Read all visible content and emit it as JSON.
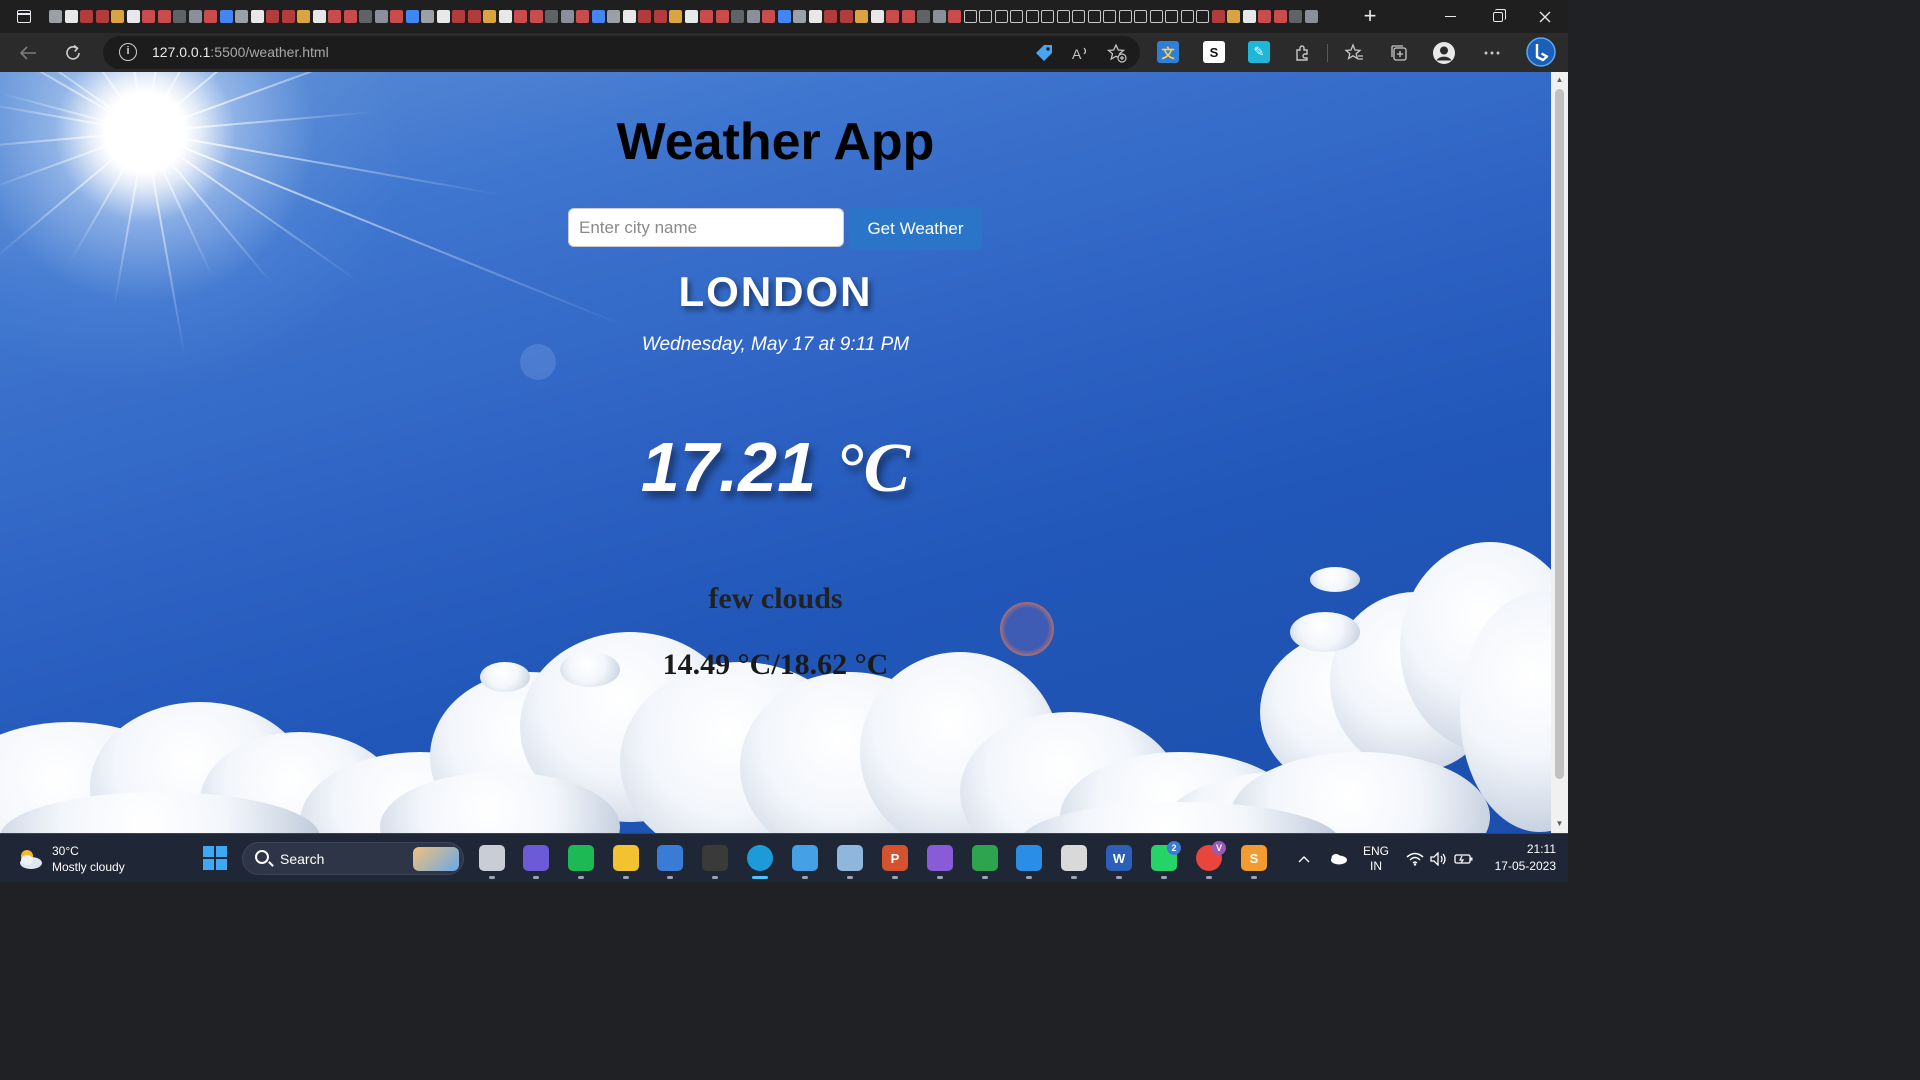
{
  "browser": {
    "url_host": "127.0.0.1",
    "url_path": ":5500/weather.html",
    "new_tab_label": "+",
    "tab_count": 82
  },
  "app": {
    "title": "Weather App",
    "search": {
      "placeholder": "Enter city name",
      "value": ""
    },
    "button_label": "Get Weather",
    "city": "LONDON",
    "datetime": "Wednesday, May 17 at 9:11 PM",
    "temperature": "17.21",
    "temperature_unit": "°C",
    "description": "few clouds",
    "min_max": "14.49 °C/18.62 °C"
  },
  "taskbar": {
    "weather_temp": "30°C",
    "weather_desc": "Mostly cloudy",
    "search_label": "Search",
    "lang_top": "ENG",
    "lang_bottom": "IN",
    "time": "21:11",
    "date": "17-05-2023",
    "whatsapp_badge": "2",
    "chrome_badge": "V"
  }
}
